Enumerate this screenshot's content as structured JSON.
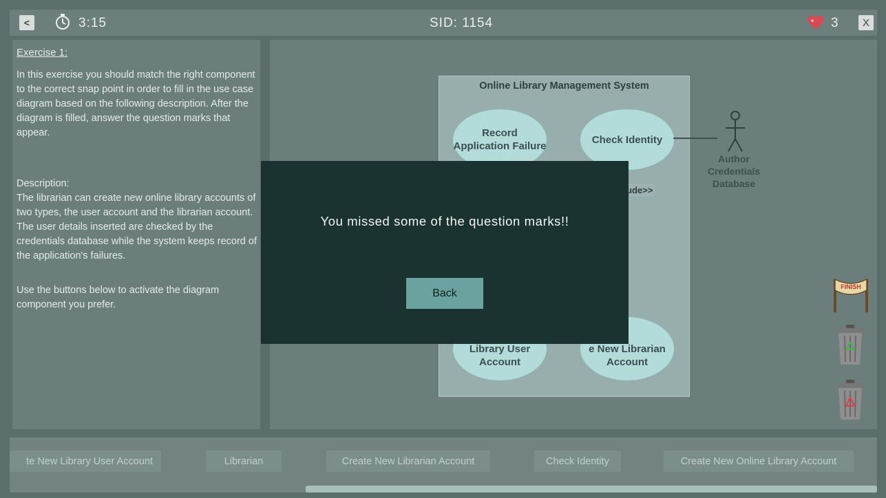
{
  "header": {
    "back_label": "<",
    "timer": "3:15",
    "sid": "SID: 1154",
    "lives": "3",
    "close_label": "X"
  },
  "left_panel": {
    "title": "Exercise 1:",
    "instructions": "In this exercise you should match the right component to the correct snap point in order to fill in the use case diagram based on the following description. After the diagram is filled, answer the question marks that appear.",
    "description_label": "Description:",
    "description": "The librarian can create new online library accounts of two types, the user account and the librarian account. The user details inserted are checked by the credentials database while the system keeps record of the application's failures.",
    "usage": "Use the buttons below to activate the diagram component you prefer."
  },
  "diagram": {
    "title": "Online Library Management System",
    "use_cases": [
      "Record Application Failure",
      "Check Identity",
      "Library User Account",
      "e New Librarian Account"
    ],
    "include_label": "ude>>",
    "actor_label": "Author Credentials Database"
  },
  "component_buttons": [
    "te New Library User Account",
    "Librarian",
    "Create New Librarian Account",
    "Check Identity",
    "Create New Online Library Account"
  ],
  "modal": {
    "message": "You missed some of the question marks!!",
    "button": "Back"
  },
  "icons": [
    "timer-icon",
    "heart-icon",
    "finish-banner-icon",
    "trash-green-icon",
    "trash-red-icon",
    "actor-icon"
  ],
  "colors": {
    "modal_bg": "#1a3331",
    "accent": "#6aa29f",
    "heart": "#d64a55"
  }
}
